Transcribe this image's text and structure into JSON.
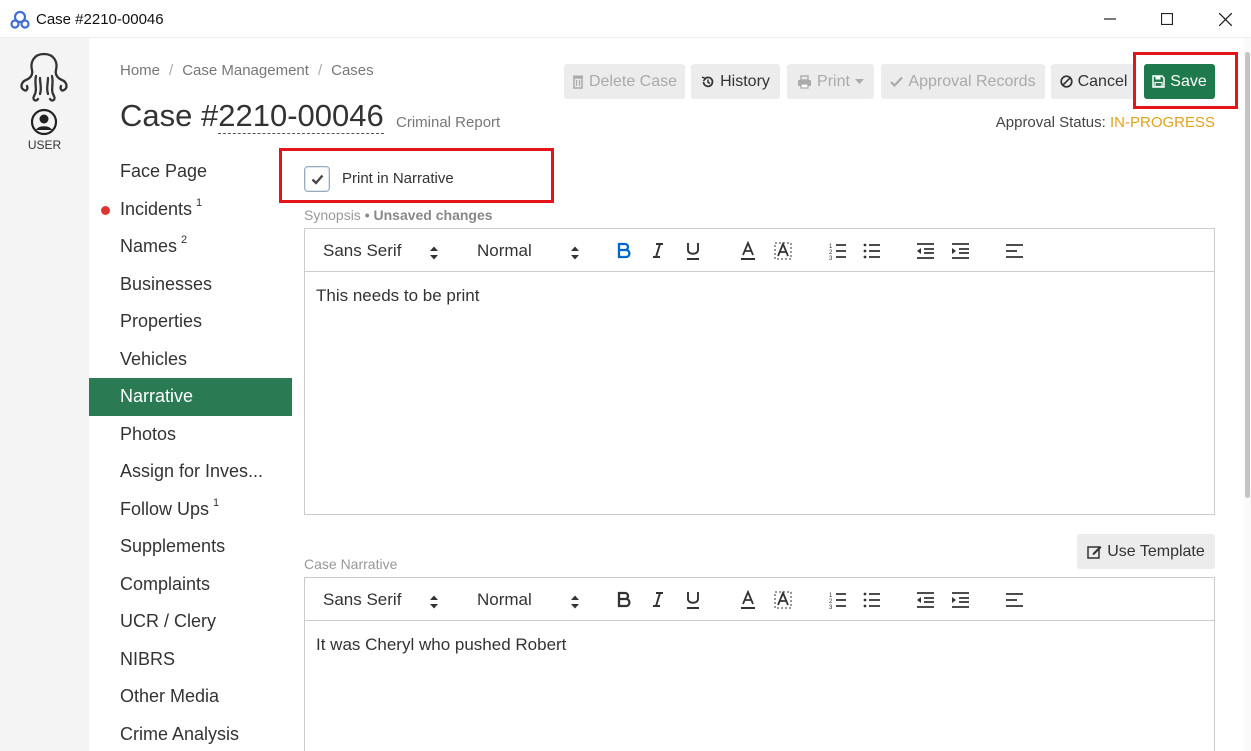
{
  "window": {
    "title": "Case #2210-00046"
  },
  "rail": {
    "user_label": "USER"
  },
  "breadcrumb": [
    "Home",
    "Case Management",
    "Cases"
  ],
  "header": {
    "case_prefix": "Case #",
    "case_number": "2210-00046",
    "case_type": "Criminal Report",
    "approval_label": "Approval Status:",
    "approval_value": "IN-PROGRESS"
  },
  "toolbar": {
    "delete": "Delete Case",
    "history": "History",
    "print": "Print",
    "approval_records": "Approval Records",
    "cancel": "Cancel",
    "save": "Save"
  },
  "nav": [
    {
      "label": "Face Page",
      "badge": ""
    },
    {
      "label": "Incidents",
      "badge": "1"
    },
    {
      "label": "Names",
      "badge": "2"
    },
    {
      "label": "Businesses",
      "badge": ""
    },
    {
      "label": "Properties",
      "badge": ""
    },
    {
      "label": "Vehicles",
      "badge": ""
    },
    {
      "label": "Narrative",
      "badge": ""
    },
    {
      "label": "Photos",
      "badge": ""
    },
    {
      "label": "Assign for Inves...",
      "badge": ""
    },
    {
      "label": "Follow Ups",
      "badge": "1"
    },
    {
      "label": "Supplements",
      "badge": ""
    },
    {
      "label": "Complaints",
      "badge": ""
    },
    {
      "label": "UCR / Clery",
      "badge": ""
    },
    {
      "label": "NIBRS",
      "badge": ""
    },
    {
      "label": "Other Media",
      "badge": ""
    },
    {
      "label": "Crime Analysis",
      "badge": ""
    }
  ],
  "narrative": {
    "print_checkbox_label": "Print in Narrative",
    "print_checked": true,
    "synopsis_label": "Synopsis",
    "unsaved": "• Unsaved changes",
    "font_family": "Sans Serif",
    "font_size": "Normal",
    "synopsis_text": "This needs to be print",
    "use_template": "Use Template",
    "case_narrative_label": "Case Narrative",
    "case_narrative_text": "It was Cheryl who pushed Robert"
  },
  "colors": {
    "accent": "#2a7a53",
    "save": "#1e7a4c",
    "highlight_box": "#e5141b",
    "status": "#e0a21f"
  }
}
